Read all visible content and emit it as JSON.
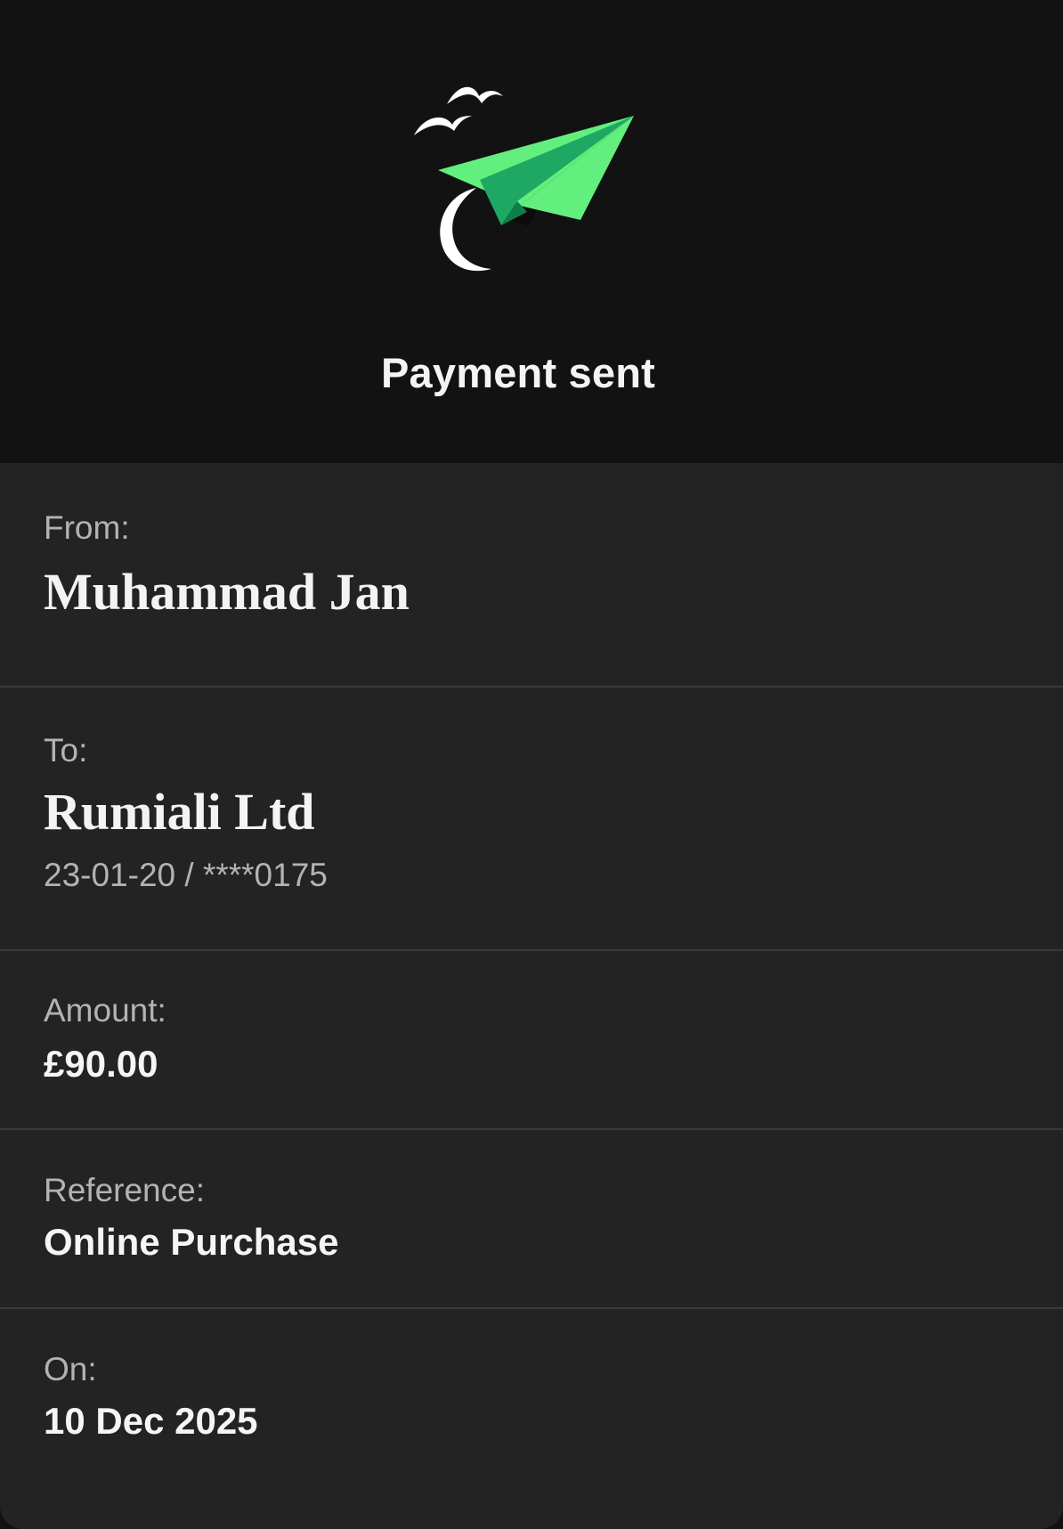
{
  "header": {
    "title": "Payment sent",
    "icon": "paper-plane-icon",
    "colors": {
      "background": "#121212",
      "plane_light": "#62ef7d",
      "plane_dark": "#1ea863",
      "accent_white": "#ffffff"
    }
  },
  "details": {
    "from": {
      "label": "From:",
      "value": "Muhammad Jan"
    },
    "to": {
      "label": "To:",
      "value": "Rumiali Ltd",
      "account": "23-01-20 / ****0175"
    },
    "amount": {
      "label": "Amount:",
      "value": "£90.00"
    },
    "reference": {
      "label": "Reference:",
      "value": "Online Purchase"
    },
    "on": {
      "label": "On:",
      "value": "10 Dec 2025"
    }
  }
}
